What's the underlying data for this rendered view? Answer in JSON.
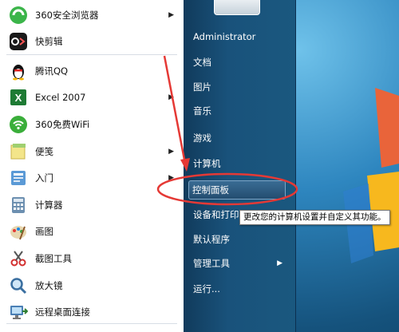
{
  "programs": [
    {
      "label": "360安全浏览器",
      "icon": "360-browser-icon",
      "arrow": true
    },
    {
      "label": "快剪辑",
      "icon": "kuaijianji-icon",
      "arrow": false
    },
    {
      "label": "腾讯QQ",
      "icon": "qq-penguin-icon",
      "arrow": false
    },
    {
      "label": "Excel 2007",
      "icon": "excel-icon",
      "arrow": true
    },
    {
      "label": "360免费WiFi",
      "icon": "wifi-icon",
      "arrow": false
    },
    {
      "label": "便笺",
      "icon": "sticky-notes-icon",
      "arrow": true
    },
    {
      "label": "入门",
      "icon": "getting-started-icon",
      "arrow": true
    },
    {
      "label": "计算器",
      "icon": "calculator-icon",
      "arrow": false
    },
    {
      "label": "画图",
      "icon": "paint-icon",
      "arrow": false
    },
    {
      "label": "截图工具",
      "icon": "snipping-tool-icon",
      "arrow": false
    },
    {
      "label": "放大镜",
      "icon": "magnifier-icon",
      "arrow": false
    },
    {
      "label": "远程桌面连接",
      "icon": "remote-desktop-icon",
      "arrow": false
    }
  ],
  "right_menu": {
    "username": "Administrator",
    "documents": "文档",
    "pictures": "图片",
    "music": "音乐",
    "games": "游戏",
    "computer": "计算机",
    "control_panel": "控制面板",
    "devices": "设备和打印",
    "default_programs": "默认程序",
    "admin_tools": "管理工具",
    "run": "运行..."
  },
  "tooltip": "更改您的计算机设置并自定义其功能。",
  "colors": {
    "annotation_red": "#e53935",
    "highlight": "#2a5a80",
    "right_pane": "#19527b"
  }
}
